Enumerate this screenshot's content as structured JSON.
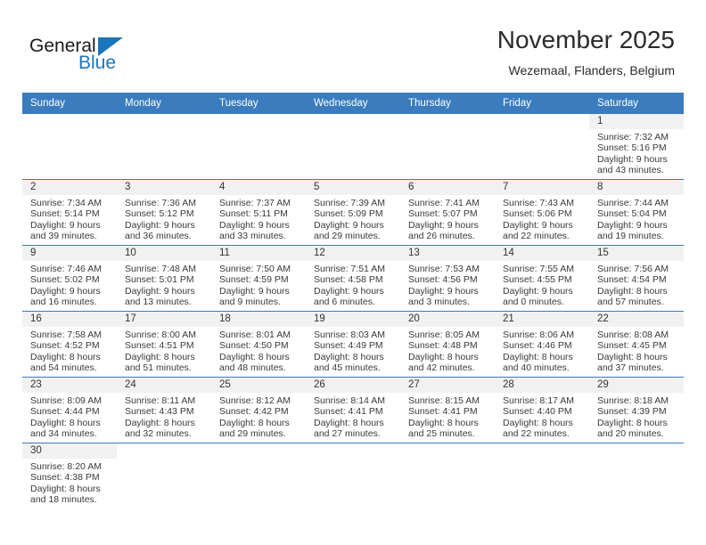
{
  "brand": {
    "name_part1": "General",
    "name_part2": "Blue",
    "triangle_icon": "triangle-icon",
    "colors": {
      "accent": "#1b75bb",
      "header": "#3a7cbe",
      "daynum_bg": "#f1f1f1"
    }
  },
  "header": {
    "title": "November 2025",
    "location": "Wezemaal, Flanders, Belgium"
  },
  "columns": [
    "Sunday",
    "Monday",
    "Tuesday",
    "Wednesday",
    "Thursday",
    "Friday",
    "Saturday"
  ],
  "labels": {
    "sunrise": "Sunrise:",
    "sunset": "Sunset:",
    "daylight": "Daylight:"
  },
  "weeks": [
    [
      {
        "blank": true
      },
      {
        "blank": true
      },
      {
        "blank": true
      },
      {
        "blank": true
      },
      {
        "blank": true
      },
      {
        "blank": true
      },
      {
        "day": "1",
        "sunrise": "Sunrise: 7:32 AM",
        "sunset": "Sunset: 5:16 PM",
        "daylight1": "Daylight: 9 hours",
        "daylight2": "and 43 minutes."
      }
    ],
    [
      {
        "day": "2",
        "sunrise": "Sunrise: 7:34 AM",
        "sunset": "Sunset: 5:14 PM",
        "daylight1": "Daylight: 9 hours",
        "daylight2": "and 39 minutes."
      },
      {
        "day": "3",
        "sunrise": "Sunrise: 7:36 AM",
        "sunset": "Sunset: 5:12 PM",
        "daylight1": "Daylight: 9 hours",
        "daylight2": "and 36 minutes."
      },
      {
        "day": "4",
        "sunrise": "Sunrise: 7:37 AM",
        "sunset": "Sunset: 5:11 PM",
        "daylight1": "Daylight: 9 hours",
        "daylight2": "and 33 minutes."
      },
      {
        "day": "5",
        "sunrise": "Sunrise: 7:39 AM",
        "sunset": "Sunset: 5:09 PM",
        "daylight1": "Daylight: 9 hours",
        "daylight2": "and 29 minutes."
      },
      {
        "day": "6",
        "sunrise": "Sunrise: 7:41 AM",
        "sunset": "Sunset: 5:07 PM",
        "daylight1": "Daylight: 9 hours",
        "daylight2": "and 26 minutes."
      },
      {
        "day": "7",
        "sunrise": "Sunrise: 7:43 AM",
        "sunset": "Sunset: 5:06 PM",
        "daylight1": "Daylight: 9 hours",
        "daylight2": "and 22 minutes."
      },
      {
        "day": "8",
        "sunrise": "Sunrise: 7:44 AM",
        "sunset": "Sunset: 5:04 PM",
        "daylight1": "Daylight: 9 hours",
        "daylight2": "and 19 minutes."
      }
    ],
    [
      {
        "day": "9",
        "sunrise": "Sunrise: 7:46 AM",
        "sunset": "Sunset: 5:02 PM",
        "daylight1": "Daylight: 9 hours",
        "daylight2": "and 16 minutes."
      },
      {
        "day": "10",
        "sunrise": "Sunrise: 7:48 AM",
        "sunset": "Sunset: 5:01 PM",
        "daylight1": "Daylight: 9 hours",
        "daylight2": "and 13 minutes."
      },
      {
        "day": "11",
        "sunrise": "Sunrise: 7:50 AM",
        "sunset": "Sunset: 4:59 PM",
        "daylight1": "Daylight: 9 hours",
        "daylight2": "and 9 minutes."
      },
      {
        "day": "12",
        "sunrise": "Sunrise: 7:51 AM",
        "sunset": "Sunset: 4:58 PM",
        "daylight1": "Daylight: 9 hours",
        "daylight2": "and 6 minutes."
      },
      {
        "day": "13",
        "sunrise": "Sunrise: 7:53 AM",
        "sunset": "Sunset: 4:56 PM",
        "daylight1": "Daylight: 9 hours",
        "daylight2": "and 3 minutes."
      },
      {
        "day": "14",
        "sunrise": "Sunrise: 7:55 AM",
        "sunset": "Sunset: 4:55 PM",
        "daylight1": "Daylight: 9 hours",
        "daylight2": "and 0 minutes."
      },
      {
        "day": "15",
        "sunrise": "Sunrise: 7:56 AM",
        "sunset": "Sunset: 4:54 PM",
        "daylight1": "Daylight: 8 hours",
        "daylight2": "and 57 minutes."
      }
    ],
    [
      {
        "day": "16",
        "sunrise": "Sunrise: 7:58 AM",
        "sunset": "Sunset: 4:52 PM",
        "daylight1": "Daylight: 8 hours",
        "daylight2": "and 54 minutes."
      },
      {
        "day": "17",
        "sunrise": "Sunrise: 8:00 AM",
        "sunset": "Sunset: 4:51 PM",
        "daylight1": "Daylight: 8 hours",
        "daylight2": "and 51 minutes."
      },
      {
        "day": "18",
        "sunrise": "Sunrise: 8:01 AM",
        "sunset": "Sunset: 4:50 PM",
        "daylight1": "Daylight: 8 hours",
        "daylight2": "and 48 minutes."
      },
      {
        "day": "19",
        "sunrise": "Sunrise: 8:03 AM",
        "sunset": "Sunset: 4:49 PM",
        "daylight1": "Daylight: 8 hours",
        "daylight2": "and 45 minutes."
      },
      {
        "day": "20",
        "sunrise": "Sunrise: 8:05 AM",
        "sunset": "Sunset: 4:48 PM",
        "daylight1": "Daylight: 8 hours",
        "daylight2": "and 42 minutes."
      },
      {
        "day": "21",
        "sunrise": "Sunrise: 8:06 AM",
        "sunset": "Sunset: 4:46 PM",
        "daylight1": "Daylight: 8 hours",
        "daylight2": "and 40 minutes."
      },
      {
        "day": "22",
        "sunrise": "Sunrise: 8:08 AM",
        "sunset": "Sunset: 4:45 PM",
        "daylight1": "Daylight: 8 hours",
        "daylight2": "and 37 minutes."
      }
    ],
    [
      {
        "day": "23",
        "sunrise": "Sunrise: 8:09 AM",
        "sunset": "Sunset: 4:44 PM",
        "daylight1": "Daylight: 8 hours",
        "daylight2": "and 34 minutes."
      },
      {
        "day": "24",
        "sunrise": "Sunrise: 8:11 AM",
        "sunset": "Sunset: 4:43 PM",
        "daylight1": "Daylight: 8 hours",
        "daylight2": "and 32 minutes."
      },
      {
        "day": "25",
        "sunrise": "Sunrise: 8:12 AM",
        "sunset": "Sunset: 4:42 PM",
        "daylight1": "Daylight: 8 hours",
        "daylight2": "and 29 minutes."
      },
      {
        "day": "26",
        "sunrise": "Sunrise: 8:14 AM",
        "sunset": "Sunset: 4:41 PM",
        "daylight1": "Daylight: 8 hours",
        "daylight2": "and 27 minutes."
      },
      {
        "day": "27",
        "sunrise": "Sunrise: 8:15 AM",
        "sunset": "Sunset: 4:41 PM",
        "daylight1": "Daylight: 8 hours",
        "daylight2": "and 25 minutes."
      },
      {
        "day": "28",
        "sunrise": "Sunrise: 8:17 AM",
        "sunset": "Sunset: 4:40 PM",
        "daylight1": "Daylight: 8 hours",
        "daylight2": "and 22 minutes."
      },
      {
        "day": "29",
        "sunrise": "Sunrise: 8:18 AM",
        "sunset": "Sunset: 4:39 PM",
        "daylight1": "Daylight: 8 hours",
        "daylight2": "and 20 minutes."
      }
    ],
    [
      {
        "day": "30",
        "sunrise": "Sunrise: 8:20 AM",
        "sunset": "Sunset: 4:38 PM",
        "daylight1": "Daylight: 8 hours",
        "daylight2": "and 18 minutes."
      },
      {
        "blank": true
      },
      {
        "blank": true
      },
      {
        "blank": true
      },
      {
        "blank": true
      },
      {
        "blank": true
      },
      {
        "blank": true
      }
    ]
  ]
}
